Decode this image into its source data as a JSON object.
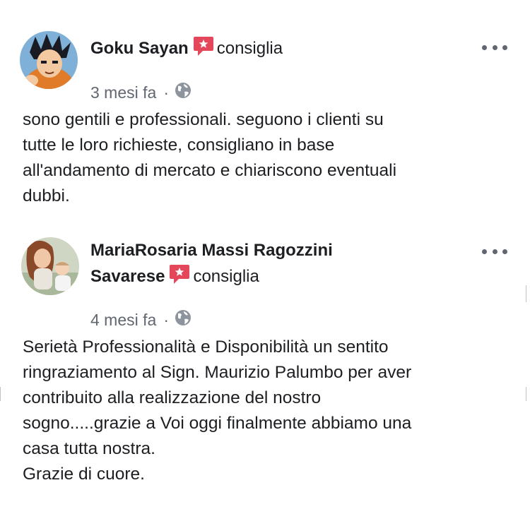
{
  "reviews": [
    {
      "author": "Goku Sayan",
      "verb": "consiglia",
      "time": "3 mesi fa",
      "separator": "·",
      "text": "sono gentili e professionali. seguono i clienti su\ntutte le loro richieste, consigliano   in base\nall'andamento di mercato e chiariscono eventuali\ndubbi."
    },
    {
      "author_line1": "MariaRosaria Massi Ragozzini",
      "author_line2": "Savarese",
      "verb": "consiglia",
      "time": "4 mesi fa",
      "separator": "·",
      "text": "Serietà  Professionalità e Disponibilità un sentito\nringraziamento al Sign. Maurizio Palumbo per aver\ncontribuito alla realizzazione del nostro\nsogno.....grazie a Voi oggi finalmente abbiamo una\ncasa tutta nostra.\nGrazie di cuore."
    }
  ],
  "icons": {
    "recommend": "recommend-icon",
    "more": "more-options-icon",
    "privacy": "globe-icon"
  },
  "colors": {
    "recommend_badge": "#e4475a",
    "meta_text": "#606770",
    "body_text": "#1c1e21"
  }
}
